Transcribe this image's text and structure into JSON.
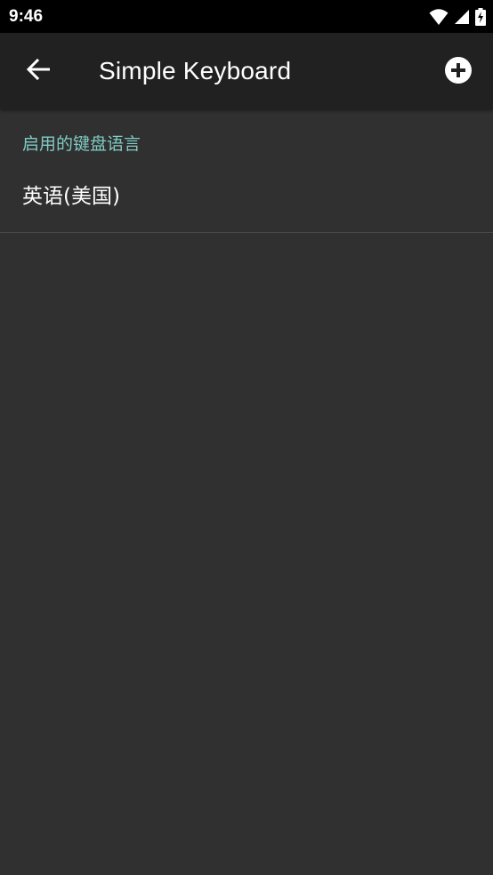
{
  "status_bar": {
    "time": "9:46",
    "icons": [
      "wifi-icon",
      "cell-signal-icon",
      "battery-charging-icon"
    ]
  },
  "app_bar": {
    "title": "Simple Keyboard",
    "back_icon": "arrow-back-icon",
    "add_icon": "add-circle-icon"
  },
  "section": {
    "header": "启用的键盘语言",
    "items": [
      {
        "label": "英语(美国)"
      }
    ]
  },
  "colors": {
    "background": "#303030",
    "app_bar": "#212121",
    "status_bar": "#000000",
    "accent": "#80cbc4",
    "divider": "#4a4a4a"
  }
}
